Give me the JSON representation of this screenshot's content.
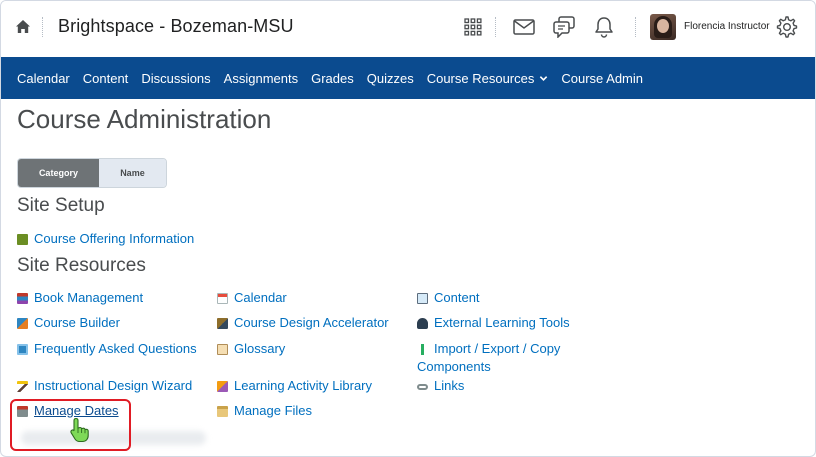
{
  "header": {
    "org_title": "Brightspace - Bozeman-MSU",
    "user_name": "Florencia Instructor",
    "icons": [
      "home-icon",
      "waffle-grid-icon",
      "mail-icon",
      "chat-icon",
      "bell-icon",
      "gear-icon"
    ]
  },
  "navbar": {
    "items": [
      "Calendar",
      "Content",
      "Discussions",
      "Assignments",
      "Grades",
      "Quizzes",
      "Course Resources",
      "Course Admin"
    ]
  },
  "page": {
    "title": "Course Administration",
    "view_toggle": {
      "category": "Category",
      "name": "Name"
    }
  },
  "site_setup": {
    "title": "Site Setup",
    "links": [
      "Course Offering Information"
    ]
  },
  "site_resources": {
    "title": "Site Resources",
    "links": [
      "Book Management",
      "Calendar",
      "Content",
      "Course Builder",
      "Course Design Accelerator",
      "External Learning Tools",
      "Frequently Asked Questions",
      "Glossary",
      "Import / Export / Copy",
      "Components",
      "Instructional Design Wizard",
      "Learning Activity Library",
      "Links",
      "Manage Dates",
      "Manage Files"
    ]
  },
  "colors": {
    "navbar_bg": "#0b4b8f",
    "link": "#006fbf",
    "highlight": "#e01b24",
    "toggle_active": "#6e7376",
    "toggle_inactive": "#e3e9f1"
  }
}
